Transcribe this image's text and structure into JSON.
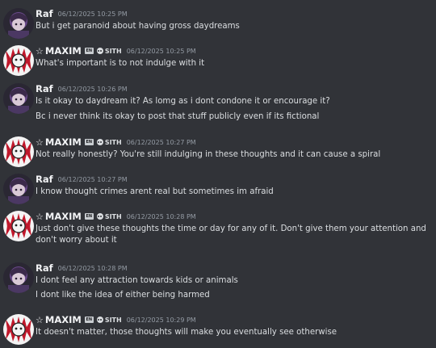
{
  "messages": [
    {
      "author": "Raf",
      "time": "06/12/2025 10:25 PM",
      "bot": false,
      "lines": [
        "But i get paranoid about having gross daydreams"
      ]
    },
    {
      "author": "MAXIM",
      "time": "06/12/2025 10:25 PM",
      "bot": true,
      "flag": "EN",
      "tag": "SITH",
      "lines": [
        "What's important is to not indulge with it"
      ]
    },
    {
      "author": "Raf",
      "time": "06/12/2025 10:26 PM",
      "bot": false,
      "lines": [
        "Is it okay to daydream it? As lomg as i dont condone it or encourage it?",
        "Bc i never think its okay to post that stuff publicly even if its fictional"
      ]
    },
    {
      "author": "MAXIM",
      "time": "06/12/2025 10:27 PM",
      "bot": true,
      "flag": "EN",
      "tag": "SITH",
      "lines": [
        "Not really honestly? You're still indulging in these thoughts and it can cause a spiral"
      ]
    },
    {
      "author": "Raf",
      "time": "06/12/2025 10:27 PM",
      "bot": false,
      "lines": [
        "I know thought crimes arent real but sometimes im afraid"
      ]
    },
    {
      "author": "MAXIM",
      "time": "06/12/2025 10:28 PM",
      "bot": true,
      "flag": "EN",
      "tag": "SITH",
      "lines": [
        "Just don't give these thoughts the time or day for any of it. Don't give them your attention and don't worry about it"
      ]
    },
    {
      "author": "Raf",
      "time": "06/12/2025 10:28 PM",
      "bot": false,
      "lines": [
        "I dont feel any attraction towards kids or animals",
        "I dont like the idea of either being harmed"
      ]
    },
    {
      "author": "MAXIM",
      "time": "06/12/2025 10:29 PM",
      "bot": true,
      "flag": "EN",
      "tag": "SITH",
      "lines": [
        "It doesn't matter, those thoughts will make you eventually see otherwise"
      ]
    }
  ],
  "colors": {
    "background": "#313338",
    "text": "#dbdee1",
    "timestamp": "#949ba4",
    "name": "#f2f3f5"
  },
  "icons": {
    "star": "star-icon",
    "flag": "flag-icon",
    "tag": "skull-icon"
  }
}
